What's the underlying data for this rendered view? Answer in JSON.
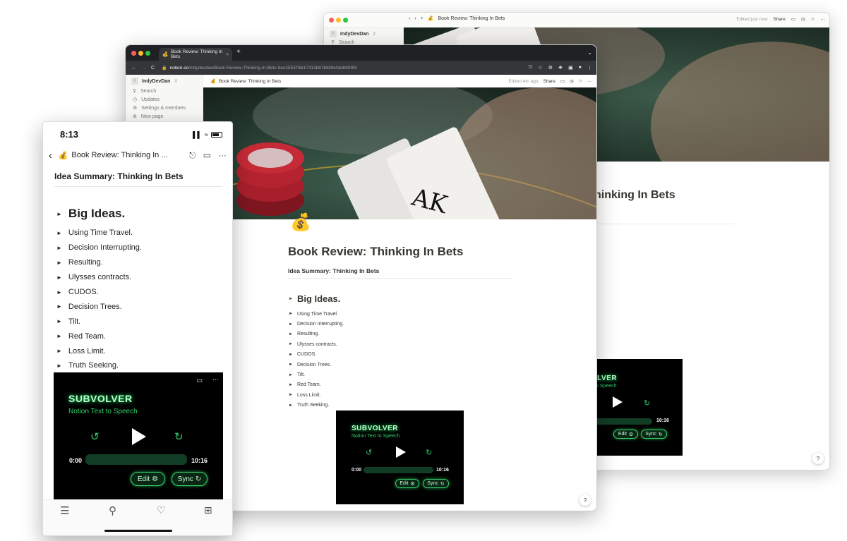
{
  "back_window": {
    "workspace": "IndyDevDan",
    "ws_initial": "I",
    "sidebar": [
      "Search"
    ],
    "page_title": "Book Review: Thinking In Bets",
    "edited": "Edited just now",
    "share": "Share",
    "heading_partial": "hinking In Bets",
    "player": {
      "title_partial": "VLVER",
      "sub_partial": "to Speech",
      "time_end": "10:16",
      "edit": "Edit",
      "sync": "Sync"
    },
    "help": "?"
  },
  "chrome_window": {
    "tab_title": "Book Review: Thinking In Bets",
    "url_domain": "notion.so",
    "url_path": "/indydevdan/Book-Review-Thinking-In-Bets-5ec255376b17413bb7bfd4b44eb95f83",
    "workspace": "IndyDevDan",
    "ws_initial": "I",
    "sidebar": [
      {
        "label": "Search",
        "icon": "search-icon"
      },
      {
        "label": "Updates",
        "icon": "clock-icon"
      },
      {
        "label": "Settings & members",
        "icon": "gear-icon"
      },
      {
        "label": "New page",
        "icon": "plus-icon"
      }
    ],
    "breadcrumb": "Book Review: Thinking In Bets",
    "edited": "Edited 4m ago",
    "share": "Share",
    "page_title": "Book Review: Thinking In Bets",
    "subheading": "Idea Summary: Thinking In Bets",
    "big_ideas": "Big Ideas.",
    "items": [
      "Using Time Travel.",
      "Decision Interrupting.",
      "Resulting.",
      "Ulysses contracts.",
      "CUDOS.",
      "Decision Trees.",
      "Tilt.",
      "Red Team.",
      "Loss Limit.",
      "Truth Seeking."
    ],
    "player": {
      "title": "SUBVOLVER",
      "sub": "Notion Text to Speech",
      "time_start": "0:00",
      "time_end": "10:16",
      "edit": "Edit",
      "sync": "Sync"
    },
    "help": "?"
  },
  "phone": {
    "time": "8:13",
    "header_title": "Book Review: Thinking In ...",
    "subheading": "Idea Summary: Thinking In Bets",
    "big_ideas": "Big Ideas.",
    "items": [
      "Using Time Travel.",
      "Decision Interrupting.",
      "Resulting.",
      "Ulysses contracts.",
      "CUDOS.",
      "Decision Trees.",
      "Tilt.",
      "Red Team.",
      "Loss Limit.",
      "Truth Seeking."
    ],
    "player": {
      "title": "SUBVOLVER",
      "sub": "Notion Text to Speech",
      "time_start": "0:00",
      "time_end": "10:16",
      "edit": "Edit",
      "sync": "Sync"
    }
  },
  "colors": {
    "accent_green": "#2fd06a",
    "notion_text": "#37352f",
    "chrome_dark": "#202124"
  }
}
